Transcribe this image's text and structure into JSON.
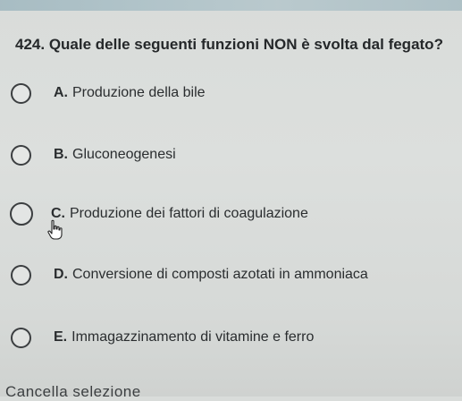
{
  "question": {
    "number": "424.",
    "text": "Quale delle seguenti funzioni NON è svolta dal fegato?"
  },
  "options": [
    {
      "letter": "A.",
      "text": "Produzione della bile",
      "selected": false
    },
    {
      "letter": "B.",
      "text": "Gluconeogenesi",
      "selected": false
    },
    {
      "letter": "C.",
      "text": "Produzione dei fattori di coagulazione",
      "selected": false
    },
    {
      "letter": "D.",
      "text": "Conversione di composti azotati in ammoniaca",
      "selected": false
    },
    {
      "letter": "E.",
      "text": "Immagazzinamento di vitamine e ferro",
      "selected": false
    }
  ],
  "footer": {
    "cancel_label": "Cancella selezione"
  },
  "cursor": {
    "icon": "hand-pointer-icon"
  },
  "colors": {
    "background": "#dcdfdd",
    "text": "#2a2c2e",
    "radio_border": "#3b3e40"
  }
}
